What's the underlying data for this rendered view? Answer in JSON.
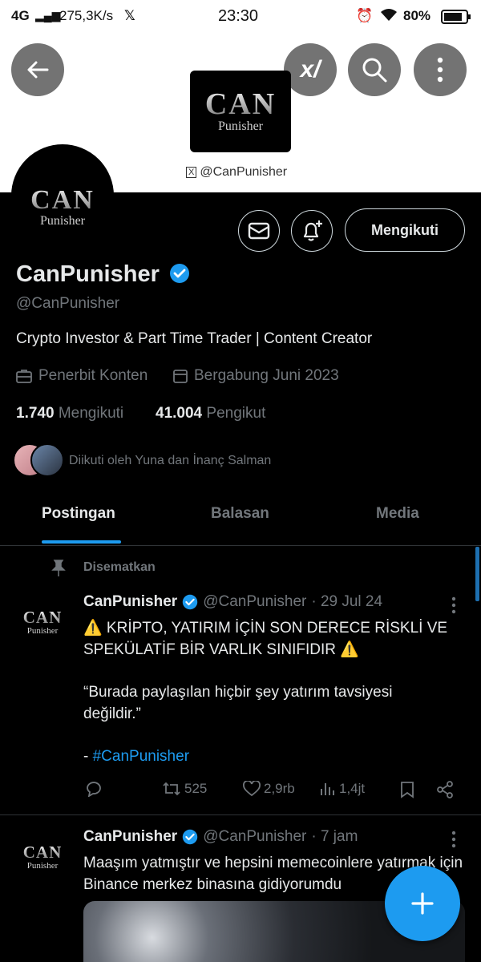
{
  "status_bar": {
    "network": "4G",
    "speed": "275,3K/s",
    "time": "23:30",
    "battery": "80%"
  },
  "banner": {
    "logo_main": "CAN",
    "logo_sub": "Punisher",
    "handle_caption": "@CanPunisher"
  },
  "profile": {
    "avatar_main": "CAN",
    "avatar_sub": "Punisher",
    "follow_button": "Mengikuti",
    "name": "CanPunisher",
    "handle": "@CanPunisher",
    "bio": "Crypto Investor & Part Time Trader | Content Creator",
    "category": "Penerbit Konten",
    "joined": "Bergabung Juni 2023",
    "following_count": "1.740",
    "following_label": "Mengikuti",
    "followers_count": "41.004",
    "followers_label": "Pengikut",
    "followed_by": "Diikuti oleh Yuna dan İnanç Salman"
  },
  "tabs": [
    {
      "label": "Postingan",
      "active": true
    },
    {
      "label": "Balasan",
      "active": false
    },
    {
      "label": "Media",
      "active": false
    }
  ],
  "posts": [
    {
      "pinned_label": "Disematkan",
      "avatar_main": "CAN",
      "avatar_sub": "Punisher",
      "name": "CanPunisher",
      "handle": "@CanPunisher",
      "time": "· 29 Jul 24",
      "warning_line": "⚠️ KRİPTO, YATIRIM İÇİN SON DERECE RİSKLİ VE SPEKÜLATİF BİR VARLIK SINIFIDIR ⚠️",
      "quote_line": "“Burada paylaşılan hiçbir şey yatırım tavsiyesi değildir.”",
      "hashtag_prefix": "- ",
      "hashtag": "#CanPunisher",
      "reposts": "525",
      "likes": "2,9rb",
      "views": "1,4jt"
    },
    {
      "avatar_main": "CAN",
      "avatar_sub": "Punisher",
      "name": "CanPunisher",
      "handle": "@CanPunisher",
      "time": "· 7 jam",
      "text": "Maaşım yatmıştır ve hepsini memecoinlere yatırmak için Binance merkez binasına gidiyorumdu"
    }
  ],
  "colors": {
    "accent": "#1d9bf0",
    "verified": "#1d9bf0",
    "background": "#000000",
    "muted": "#71767b"
  }
}
